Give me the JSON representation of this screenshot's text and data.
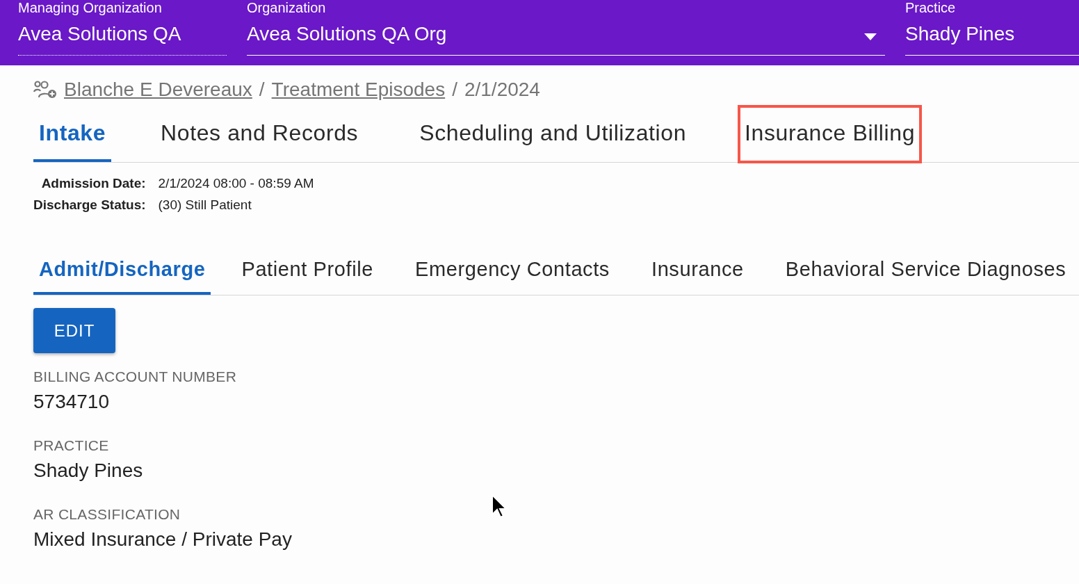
{
  "header": {
    "fields": [
      {
        "label": "Managing Organization",
        "value": "Avea Solutions QA",
        "kind": "readonly"
      },
      {
        "label": "Organization",
        "value": "Avea Solutions QA Org",
        "kind": "dropdown"
      },
      {
        "label": "Practice",
        "value": "Shady Pines",
        "kind": "text"
      }
    ]
  },
  "breadcrumb": [
    {
      "kind": "link",
      "text": "Blanche E Devereaux"
    },
    {
      "kind": "separator",
      "text": "/"
    },
    {
      "kind": "link",
      "text": "Treatment Episodes"
    },
    {
      "kind": "separator",
      "text": "/"
    },
    {
      "kind": "current",
      "text": "2/1/2024"
    }
  ],
  "main_tabs": [
    {
      "label": "Intake",
      "selected": true,
      "highlighted": false
    },
    {
      "label": "Notes and Records",
      "selected": false,
      "highlighted": false
    },
    {
      "label": "Scheduling and Utilization",
      "selected": false,
      "highlighted": false
    },
    {
      "label": "Insurance Billing",
      "selected": false,
      "highlighted": true
    }
  ],
  "summary": [
    {
      "label": "Admission Date:",
      "value": "2/1/2024 08:00 - 08:59 AM"
    },
    {
      "label": "Discharge Status:",
      "value": "(30) Still Patient"
    }
  ],
  "sub_tabs": [
    {
      "label": "Admit/Discharge",
      "selected": true
    },
    {
      "label": "Patient Profile",
      "selected": false
    },
    {
      "label": "Emergency Contacts",
      "selected": false
    },
    {
      "label": "Insurance",
      "selected": false
    },
    {
      "label": "Behavioral Service Diagnoses",
      "selected": false
    }
  ],
  "edit_button": "EDIT",
  "details": [
    {
      "label": "BILLING ACCOUNT NUMBER",
      "value": "5734710"
    },
    {
      "label": "PRACTICE",
      "value": "Shady Pines"
    },
    {
      "label": "AR CLASSIFICATION",
      "value": "Mixed Insurance / Private Pay"
    }
  ]
}
